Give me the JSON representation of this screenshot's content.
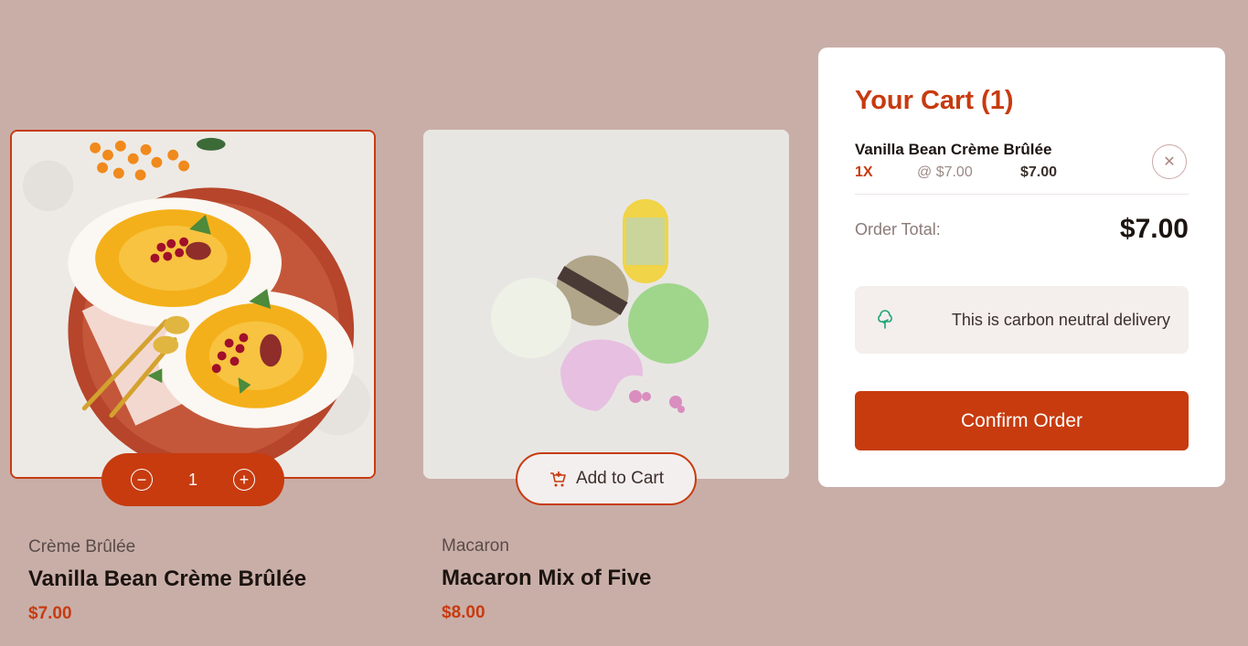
{
  "products": [
    {
      "category": "Crème Brûlée",
      "name": "Vanilla Bean Crème Brûlée",
      "price": "$7.00",
      "quantity": "1",
      "image_icon": "creme-brulee-image",
      "in_cart": true
    },
    {
      "category": "Macaron",
      "name": "Macaron Mix of Five",
      "price": "$8.00",
      "add_label": "Add to Cart",
      "image_icon": "macaron-image",
      "in_cart": false
    }
  ],
  "cart": {
    "title": "Your Cart (1)",
    "items": [
      {
        "name": "Vanilla Bean Crème Brûlée",
        "qty": "1X",
        "unit_price": "@ $7.00",
        "total": "$7.00"
      }
    ],
    "order_total_label": "Order Total:",
    "order_total": "$7.00",
    "carbon_text": "This is carbon neutral delivery",
    "confirm_label": "Confirm Order"
  },
  "colors": {
    "accent": "#c73b0f",
    "background": "#c9aea8",
    "dark_text": "#1c1410",
    "eco_green": "#1ea575"
  }
}
